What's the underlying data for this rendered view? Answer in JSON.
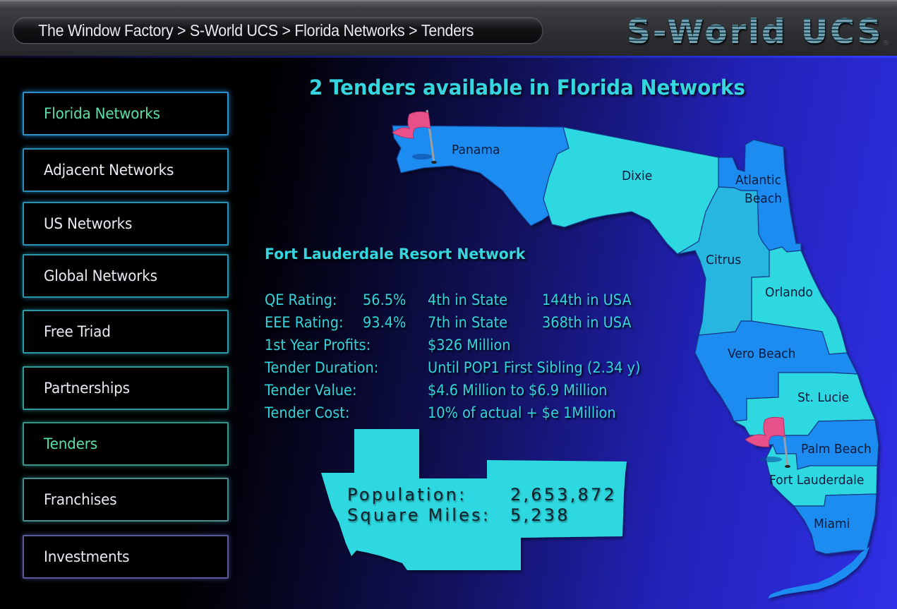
{
  "header": {
    "breadcrumb": [
      "The Window Factory",
      "S-World UCS",
      "Florida Networks",
      "Tenders"
    ],
    "separator": " > ",
    "logo": "S-World UCS",
    "registered_mark": "®"
  },
  "sidebar": {
    "items": [
      {
        "label": "Florida Networks",
        "active": true
      },
      {
        "label": "Adjacent Networks",
        "active": false
      },
      {
        "label": "US Networks",
        "active": false
      },
      {
        "label": "Global Networks",
        "active": false
      },
      {
        "label": "Free Triad",
        "active": false
      },
      {
        "label": "Partnerships",
        "active": false
      },
      {
        "label": "Tenders",
        "active": true
      },
      {
        "label": "Franchises",
        "active": false
      },
      {
        "label": "Investments",
        "active": false
      }
    ]
  },
  "main": {
    "title": "2 Tenders available in Florida Networks",
    "map": {
      "regions": [
        {
          "name": "Panama",
          "color": "#1a8cf0",
          "flagged": true
        },
        {
          "name": "Dixie",
          "color": "#2ed8e0",
          "flagged": false
        },
        {
          "name": "Atlantic Beach",
          "color": "#1a8cf0",
          "flagged": false
        },
        {
          "name": "Citrus",
          "color": "#25b6e0",
          "flagged": false
        },
        {
          "name": "Orlando",
          "color": "#2ed8e0",
          "flagged": false
        },
        {
          "name": "Vero Beach",
          "color": "#1a8cf0",
          "flagged": false
        },
        {
          "name": "St. Lucie",
          "color": "#2ed8e0",
          "flagged": false
        },
        {
          "name": "Palm Beach",
          "color": "#1a8cf0",
          "flagged": false
        },
        {
          "name": "Fort Lauderdale",
          "color": "#2ed8e0",
          "flagged": true
        },
        {
          "name": "Miami",
          "color": "#1a8cf0",
          "flagged": false
        }
      ],
      "labels": {
        "panama": "Panama",
        "dixie": "Dixie",
        "atlantic_1": "Atlantic",
        "atlantic_2": "Beach",
        "citrus": "Citrus",
        "orlando": "Orlando",
        "vero": "Vero Beach",
        "stlucie": "St. Lucie",
        "palm": "Palm Beach",
        "fortl": "Fort Lauderdale",
        "miami": "Miami"
      },
      "flag_color": "#e8508a"
    },
    "network": {
      "name": "Fort Lauderdale Resort Network",
      "qe": {
        "label": "QE Rating:",
        "value": "56.5%",
        "state_rank": "4th in State",
        "usa_rank": "144th in USA"
      },
      "eee": {
        "label": "EEE Rating:",
        "value": "93.4%",
        "state_rank": "7th in State",
        "usa_rank": "368th in USA"
      },
      "rows": [
        {
          "label": "1st Year Profits:",
          "value": "$326 Million"
        },
        {
          "label": "Tender Duration:",
          "value": "Until POP1 First Sibling (2.34 y)"
        },
        {
          "label": "Tender Value:",
          "value": "$4.6 Million to $6.9 Million"
        },
        {
          "label": "Tender Cost:",
          "value": "10% of actual + $e 1Million"
        }
      ]
    },
    "area": {
      "population_label": "Population:",
      "population": "2,653,872",
      "sqmi_label": "Square Miles:",
      "sqmi": "5,238",
      "color": "#2ed8e0"
    }
  },
  "colors": {
    "accent_text": "#35d6df",
    "active_nav": "#59e0a7",
    "nav_border": "#2a8fb8"
  }
}
